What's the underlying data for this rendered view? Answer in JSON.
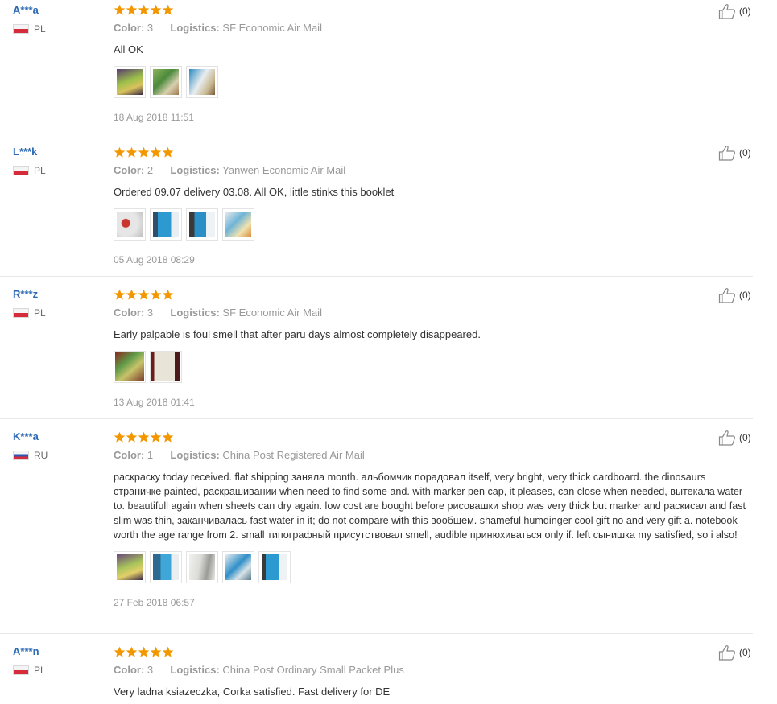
{
  "colors": {
    "accent_user": "#2d6ab3",
    "star": "#f39700",
    "muted": "#999999",
    "text": "#333333",
    "divider": "#e8e8e8"
  },
  "labels": {
    "color_key": "Color:",
    "logistics_key": "Logistics:"
  },
  "reviews": [
    {
      "user": "A***a",
      "country": "PL",
      "rating_stars": 5,
      "color": "3",
      "logistics": "SF Economic Air Mail",
      "text": "All OK",
      "photos": [
        "photo-1",
        "photo-2",
        "photo-3"
      ],
      "date": "18 Aug 2018 11:51",
      "helpful_count": "(0)"
    },
    {
      "user": "L***k",
      "country": "PL",
      "rating_stars": 5,
      "color": "2",
      "logistics": "Yanwen Economic Air Mail",
      "text": "Ordered 09.07 delivery 03.08. All OK, little stinks this booklet",
      "photos": [
        "photo-1",
        "photo-2",
        "photo-3",
        "photo-4"
      ],
      "date": "05 Aug 2018 08:29",
      "helpful_count": "(0)"
    },
    {
      "user": "R***z",
      "country": "PL",
      "rating_stars": 5,
      "color": "3",
      "logistics": "SF Economic Air Mail",
      "text": "Early palpable is foul smell that after paru days almost completely disappeared.",
      "photos": [
        "photo-1",
        "photo-2"
      ],
      "date": "13 Aug 2018 01:41",
      "helpful_count": "(0)"
    },
    {
      "user": "K***a",
      "country": "RU",
      "rating_stars": 5,
      "color": "1",
      "logistics": "China Post Registered Air Mail",
      "text": "раскраску today received. flat shipping заняла month. альбомчик порадовал itself, very bright, very thick cardboard. the dinosaurs страничке painted, раскрашивании when need to find some and. with marker pen cap, it pleases, can close when needed, вытекала water to. beautifull again when sheets can dry again. low cost are bought before рисовашки shop was very thick but marker and раскисал and fast slim was thin, заканчивалась fast water in it; do not compare with this вообщем. shameful humdinger cool gift no and very gift a. notebook worth the age range from 2. small типографный присутствовал smell, audible принюхиваться only if. left сынишка my satisfied, so i also!",
      "photos": [
        "photo-1",
        "photo-2",
        "photo-3",
        "photo-4",
        "photo-5"
      ],
      "date": "27 Feb 2018 06:57",
      "helpful_count": "(0)"
    },
    {
      "user": "A***n",
      "country": "PL",
      "rating_stars": 5,
      "color": "3",
      "logistics": "China Post Ordinary Small Packet Plus",
      "text": "Very ladna ksiazeczka, Corka satisfied. Fast delivery for DE",
      "photos": [],
      "date": "",
      "helpful_count": "(0)"
    }
  ]
}
